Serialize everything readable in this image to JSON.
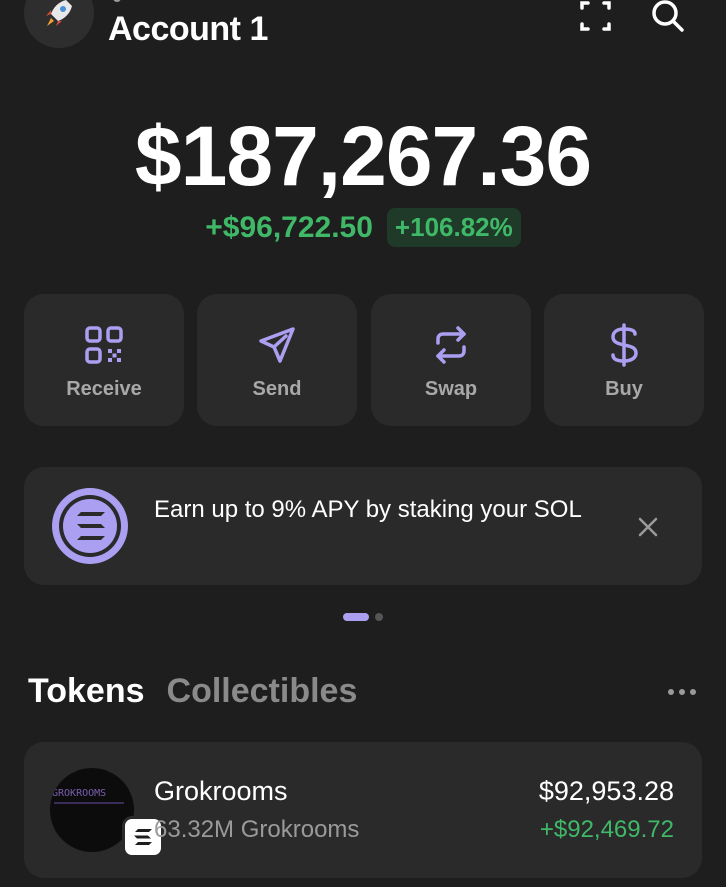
{
  "header": {
    "account_name": "Account 1",
    "avatar_icon": "rocket-icon",
    "scan_icon": "scan-icon",
    "search_icon": "search-icon"
  },
  "balance": {
    "total": "$187,267.36",
    "change_amount": "+$96,722.50",
    "change_percent": "+106.82%"
  },
  "actions": [
    {
      "label": "Receive",
      "icon": "qr-code-icon"
    },
    {
      "label": "Send",
      "icon": "send-icon"
    },
    {
      "label": "Swap",
      "icon": "swap-icon"
    },
    {
      "label": "Buy",
      "icon": "dollar-icon"
    }
  ],
  "promo": {
    "text": "Earn up to 9% APY by staking your SOL",
    "icon": "solana-icon",
    "close_icon": "close-icon"
  },
  "tabs": [
    {
      "label": "Tokens",
      "active": true
    },
    {
      "label": "Collectibles",
      "active": false
    }
  ],
  "tokens": [
    {
      "name": "Grokrooms",
      "amount": "63.32M Grokrooms",
      "value": "$92,953.28",
      "change": "+$92,469.72",
      "logo_text": "GROKROOMS"
    }
  ],
  "colors": {
    "background": "#1e1e1e",
    "card": "#2a2a2a",
    "accent": "#ab9ff2",
    "positive": "#3fb968"
  }
}
